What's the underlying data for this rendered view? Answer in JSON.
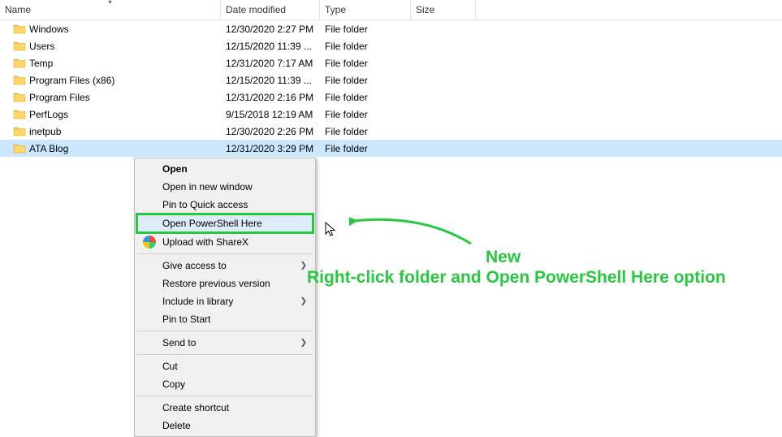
{
  "columns": {
    "name": "Name",
    "date": "Date modified",
    "type": "Type",
    "size": "Size"
  },
  "files": [
    {
      "name": "Windows",
      "date": "12/30/2020 2:27 PM",
      "type": "File folder"
    },
    {
      "name": "Users",
      "date": "12/15/2020 11:39 ...",
      "type": "File folder"
    },
    {
      "name": "Temp",
      "date": "12/31/2020 7:17 AM",
      "type": "File folder"
    },
    {
      "name": "Program Files (x86)",
      "date": "12/15/2020 11:39 ...",
      "type": "File folder"
    },
    {
      "name": "Program Files",
      "date": "12/31/2020 2:16 PM",
      "type": "File folder"
    },
    {
      "name": "PerfLogs",
      "date": "9/15/2018 12:19 AM",
      "type": "File folder"
    },
    {
      "name": "inetpub",
      "date": "12/30/2020 2:26 PM",
      "type": "File folder"
    },
    {
      "name": "ATA Blog",
      "date": "12/31/2020 3:29 PM",
      "type": "File folder",
      "selected": true
    }
  ],
  "ctx": {
    "open": "Open",
    "open_new": "Open in new window",
    "pin_quick": "Pin to Quick access",
    "powershell": "Open PowerShell Here",
    "sharex": "Upload with ShareX",
    "give_access": "Give access to",
    "restore_prev": "Restore previous version",
    "include_lib": "Include in library",
    "pin_start": "Pin to Start",
    "send_to": "Send to",
    "cut": "Cut",
    "copy": "Copy",
    "shortcut": "Create shortcut",
    "delete": "Delete"
  },
  "anno": {
    "line1": "New",
    "line2": "Right-click folder and Open PowerShell Here option"
  }
}
